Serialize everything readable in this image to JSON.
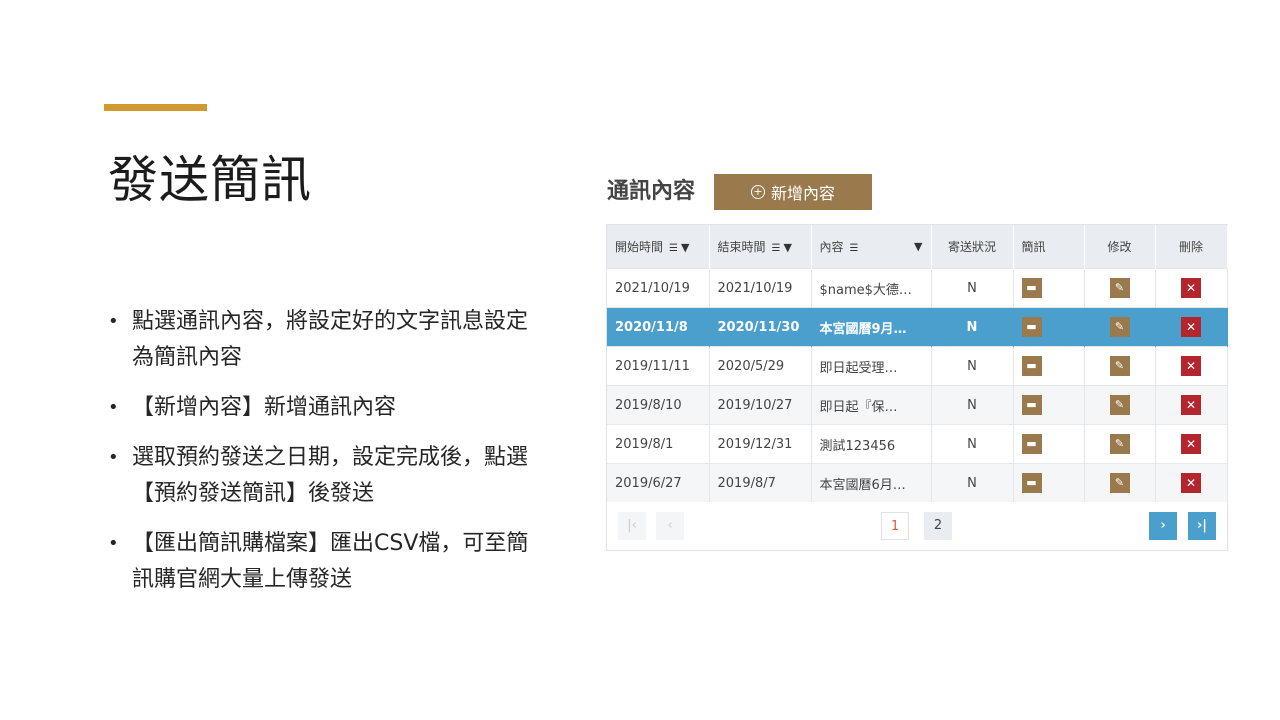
{
  "slide": {
    "title": "發送簡訊",
    "bullets": [
      "點選通訊內容，將設定好的文字訊息設定為簡訊內容",
      "【新增內容】新增通訊內容",
      "選取預約發送之日期，設定完成後，點選【預約發送簡訊】後發送",
      "【匯出簡訊購檔案】匯出CSV檔，可至簡訊購官網大量上傳發送"
    ],
    "bullet_marker": "•",
    "accent_color": "#d09a2e"
  },
  "panel": {
    "heading": "通訊內容",
    "add_button_label": "新增內容",
    "add_button_icon": "plus-circle-icon",
    "columns": {
      "start": "開始時間",
      "end": "結束時間",
      "content": "內容",
      "status": "寄送狀況",
      "sms": "簡訊",
      "edit": "修改",
      "delete": "刪除"
    },
    "rows": [
      {
        "start": "2021/10/19",
        "end": "2021/10/19",
        "content": "$name$大德…",
        "status": "N"
      },
      {
        "start": "2020/11/8",
        "end": "2020/11/30",
        "content": "本宮國曆9月…",
        "status": "N"
      },
      {
        "start": "2019/11/11",
        "end": "2020/5/29",
        "content": "即日起受理…",
        "status": "N"
      },
      {
        "start": "2019/8/10",
        "end": "2019/10/27",
        "content": "即日起『保…",
        "status": "N"
      },
      {
        "start": "2019/8/1",
        "end": "2019/12/31",
        "content": "測試123456",
        "status": "N"
      },
      {
        "start": "2019/6/27",
        "end": "2019/8/7",
        "content": "本宮國曆6月…",
        "status": "N"
      }
    ],
    "selected_row": 1,
    "pager": {
      "first": "|‹",
      "prev": "‹",
      "pages": [
        "1",
        "2"
      ],
      "current": "1",
      "next": "›",
      "last": "›|"
    },
    "colors": {
      "brown": "#9a7a4c",
      "selected": "#4a9fcd",
      "delete": "#b5252d"
    }
  }
}
